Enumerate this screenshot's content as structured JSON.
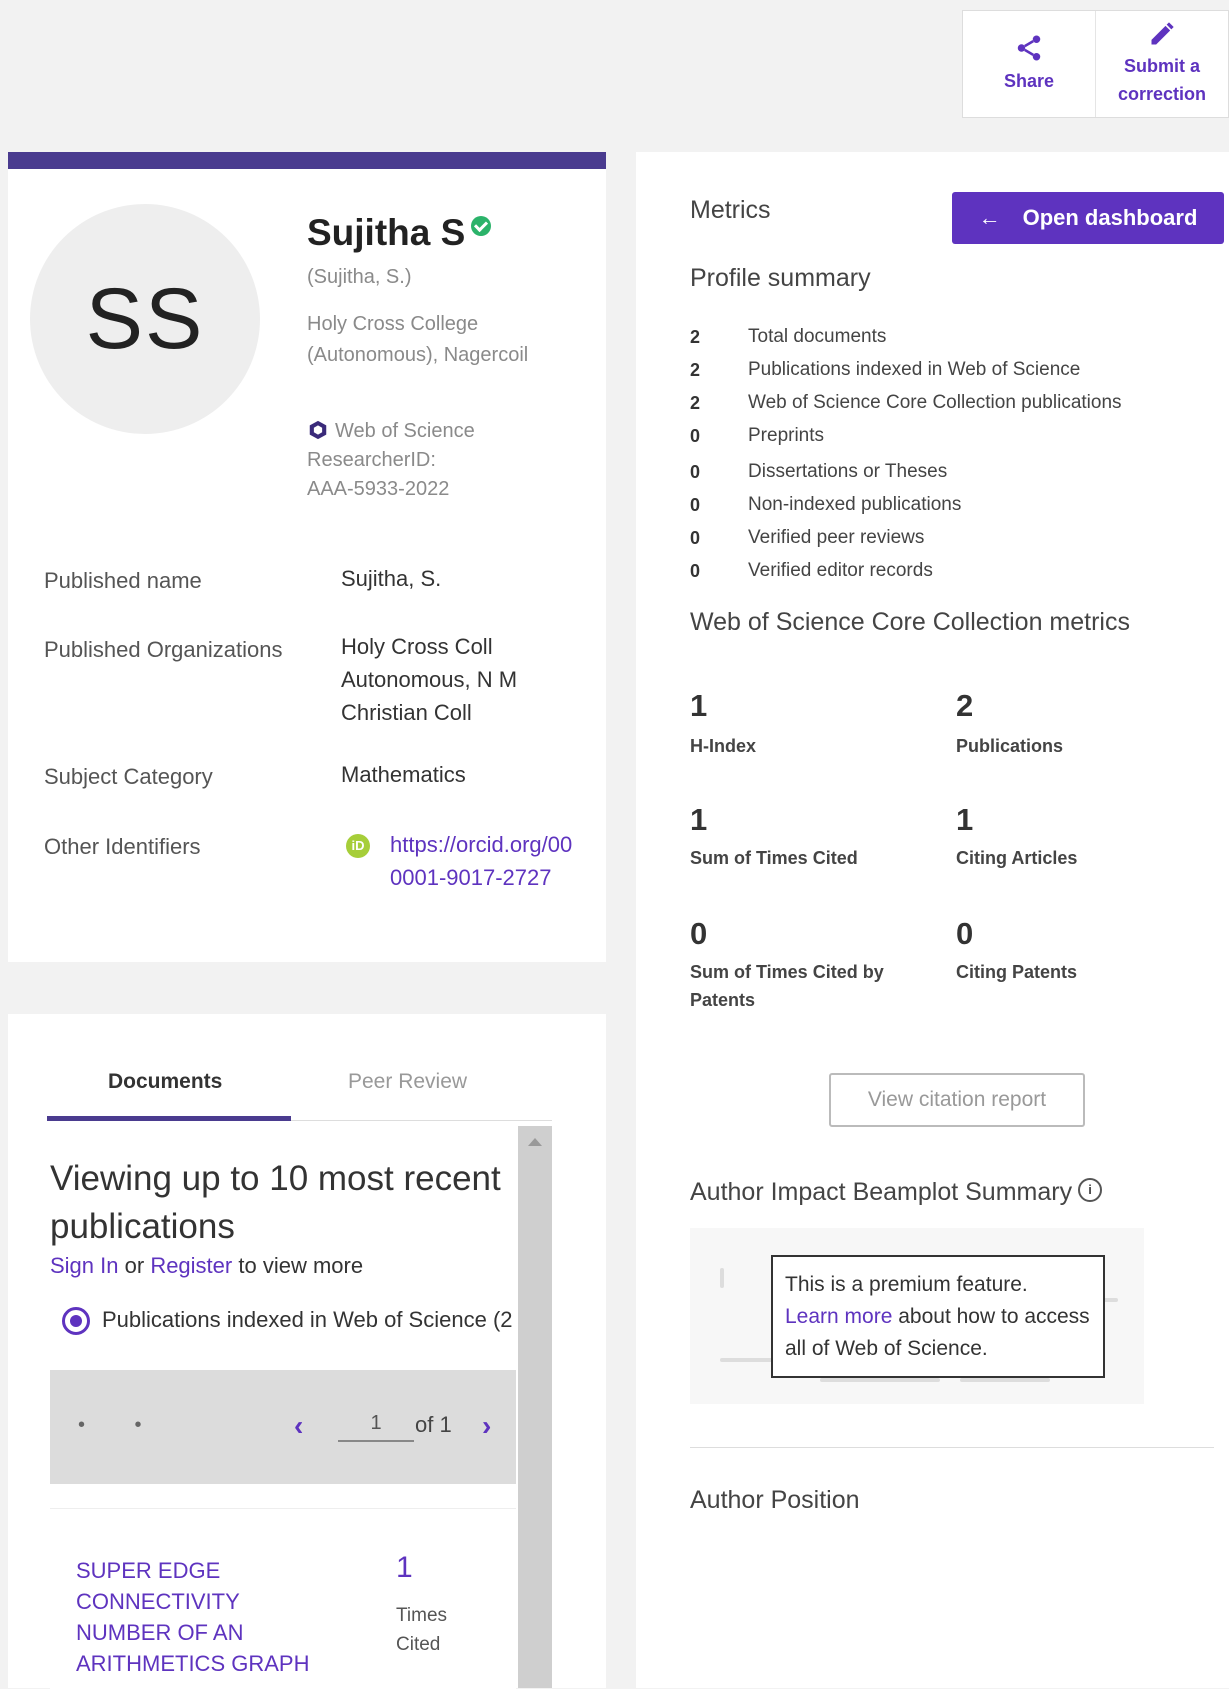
{
  "actions": {
    "share_label": "Share",
    "correction_label_line1": "Submit a",
    "correction_label_line2": "correction"
  },
  "profile": {
    "initials": "SS",
    "name": "Sujitha S",
    "alt_name": "(Sujitha, S.)",
    "affiliation_line1": "Holy Cross College",
    "affiliation_line2": "(Autonomous), Nagercoil",
    "wos_label": "Web of Science",
    "researcher_id_label": "ResearcherID:",
    "researcher_id": "AAA-5933-2022",
    "published_name_label": "Published name",
    "published_name": "Sujitha, S.",
    "published_orgs_label": "Published Organizations",
    "published_orgs_line1": "Holy Cross Coll",
    "published_orgs_line2": "Autonomous,  N M",
    "published_orgs_line3": "Christian Coll",
    "subject_label": "Subject Category",
    "subject": "Mathematics",
    "other_ids_label": "Other Identifiers",
    "orcid_icon_text": "iD",
    "orcid_line1": "https://orcid.org/00",
    "orcid_line2": "0001-9017-2727"
  },
  "documents": {
    "tab_documents": "Documents",
    "tab_peer_review": "Peer Review",
    "title": "Viewing up to 10 most recent publications",
    "sign_in": "Sign In",
    "or": "or",
    "register": "Register",
    "to_view_more": "to view more",
    "filter_label": "Publications indexed in Web of Science (2",
    "pager_dots": "• •",
    "prev": "‹",
    "next": "›",
    "page": "1",
    "of_total": "of 1",
    "result_title": "SUPER EDGE CONNECTIVITY NUMBER OF AN ARITHMETICS GRAPH",
    "result_count": "1",
    "result_cited_line1": "Times",
    "result_cited_line2": "Cited"
  },
  "metrics": {
    "title": "Metrics",
    "dashboard_button": "Open dashboard",
    "profile_summary_title": "Profile summary",
    "summary": [
      {
        "count": "2",
        "label": "Total documents"
      },
      {
        "count": "2",
        "label": "Publications indexed in Web of Science"
      },
      {
        "count": "2",
        "label": "Web of Science Core Collection publications"
      },
      {
        "count": "0",
        "label": "Preprints"
      },
      {
        "count": "0",
        "label": "Dissertations or Theses"
      },
      {
        "count": "0",
        "label": "Non-indexed publications"
      },
      {
        "count": "0",
        "label": "Verified peer reviews"
      },
      {
        "count": "0",
        "label": "Verified editor records"
      }
    ],
    "core_title": "Web of Science Core Collection metrics",
    "core": [
      {
        "value": "1",
        "label": "H-Index"
      },
      {
        "value": "2",
        "label": "Publications"
      },
      {
        "value": "1",
        "label": "Sum of Times Cited"
      },
      {
        "value": "1",
        "label": "Citing Articles"
      },
      {
        "value": "0",
        "label": "Sum of Times Cited by Patents"
      },
      {
        "value": "0",
        "label": "Citing Patents"
      }
    ],
    "citation_report_button": "View citation report",
    "beamplot_title": "Author Impact Beamplot Summary",
    "info_icon_text": "i",
    "premium_text": "This is a premium feature.",
    "learn_more": "Learn more",
    "premium_text_2": "about how to access all of Web of Science.",
    "author_position_title": "Author Position"
  }
}
